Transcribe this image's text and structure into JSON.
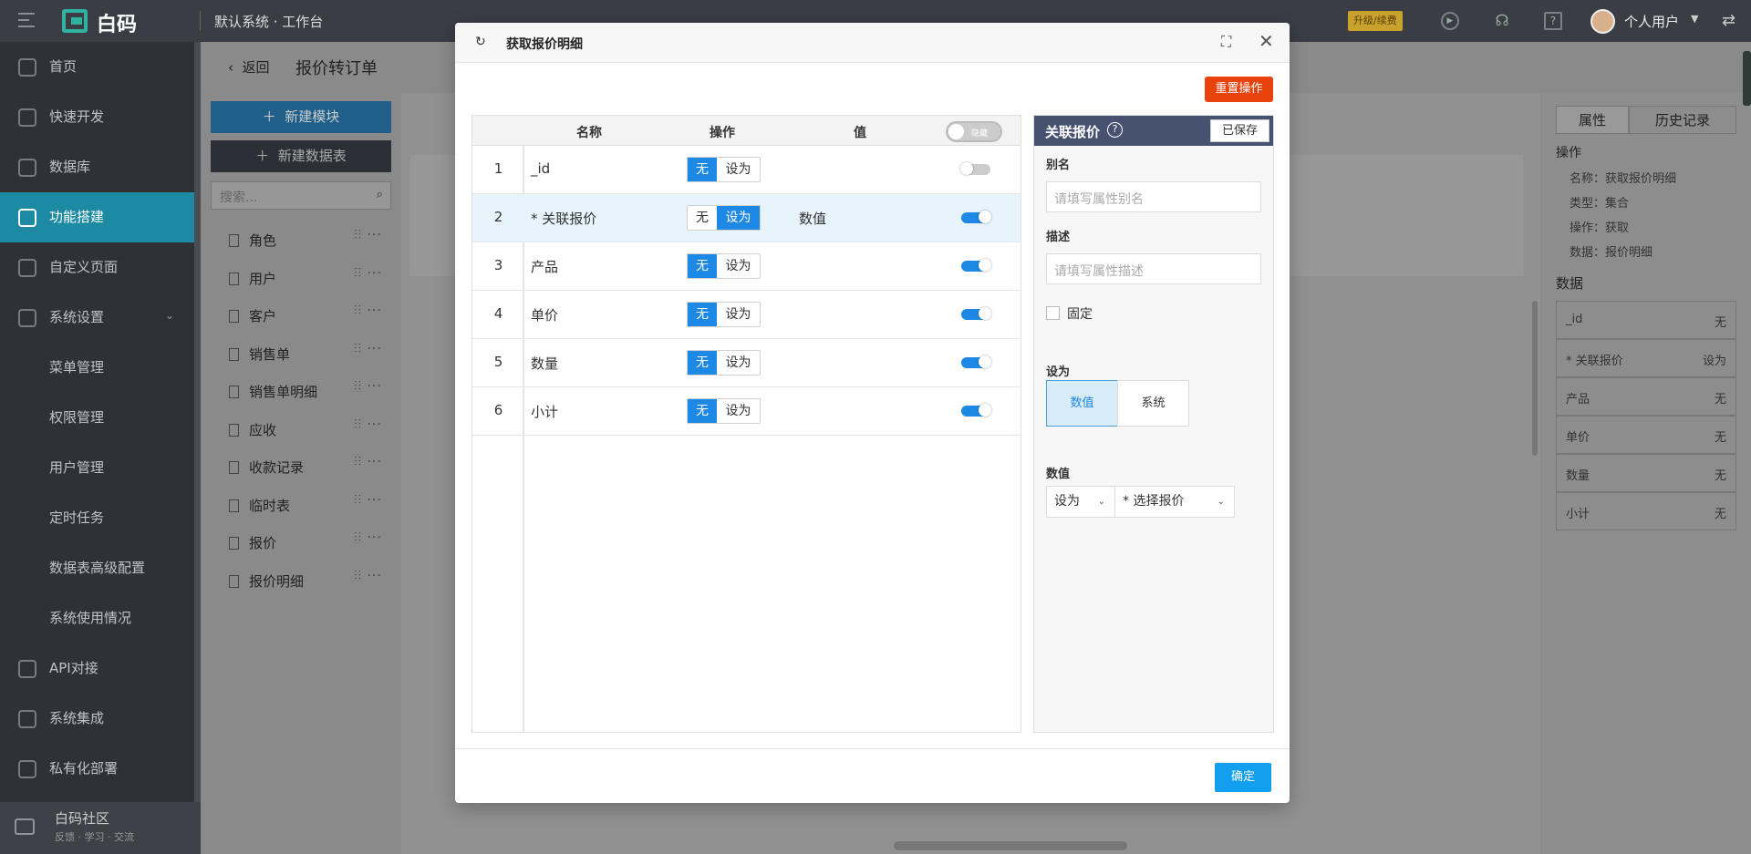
{
  "topbar": {
    "brand": "白码",
    "workspace": "默认系统 · 工作台",
    "upgrade": "升级/续费",
    "username": "个人用户"
  },
  "sidebar": {
    "items": [
      {
        "label": "首页",
        "icon": "home-icon"
      },
      {
        "label": "快速开发",
        "icon": "cube-icon"
      },
      {
        "label": "数据库",
        "icon": "database-icon"
      },
      {
        "label": "功能搭建",
        "icon": "build-icon",
        "active": true
      },
      {
        "label": "自定义页面",
        "icon": "page-icon"
      },
      {
        "label": "系统设置",
        "icon": "settings-icon",
        "expanded": true
      },
      {
        "label": "菜单管理"
      },
      {
        "label": "权限管理"
      },
      {
        "label": "用户管理"
      },
      {
        "label": "定时任务"
      },
      {
        "label": "数据表高级配置"
      },
      {
        "label": "系统使用情况"
      },
      {
        "label": "API对接",
        "icon": "api-icon"
      },
      {
        "label": "系统集成",
        "icon": "layers-icon"
      },
      {
        "label": "私有化部署",
        "icon": "lock-icon"
      }
    ],
    "community_title": "白码社区",
    "community_sub": "反馈 · 学习 · 交流"
  },
  "main": {
    "back_label": "返回",
    "page_title": "报价转订单",
    "new_module": "新建模块",
    "new_table": "新建数据表",
    "search_placeholder": "搜索...",
    "tables": [
      "角色",
      "用户",
      "客户",
      "销售单",
      "销售单明细",
      "应收",
      "收款记录",
      "临时表",
      "报价",
      "报价明细"
    ]
  },
  "right_panel": {
    "tab_props": "属性",
    "tab_history": "历史记录",
    "section_op": "操作",
    "op_name": "名称：获取报价明细",
    "op_type": "类型：集合",
    "op_action": "操作：获取",
    "op_data": "数据：报价明细",
    "section_data": "数据",
    "data_rows": [
      {
        "name": "_id",
        "value": "无"
      },
      {
        "name": "* 关联报价",
        "value": "设为"
      },
      {
        "name": "产品",
        "value": "无"
      },
      {
        "name": "单价",
        "value": "无"
      },
      {
        "name": "数量",
        "value": "无"
      },
      {
        "name": "小计",
        "value": "无"
      }
    ]
  },
  "modal": {
    "title": "获取报价明细",
    "reset": "重置操作",
    "columns": {
      "name": "名称",
      "op": "操作",
      "value": "值"
    },
    "header_toggle_label": "隐藏",
    "seg_none": "无",
    "seg_set": "设为",
    "rows": [
      {
        "idx": "1",
        "name": "_id",
        "op": "none",
        "value": "",
        "on": false
      },
      {
        "idx": "2",
        "name": "* 关联报价",
        "op": "set",
        "value": "数值",
        "on": true,
        "selected": true
      },
      {
        "idx": "3",
        "name": "产品",
        "op": "none",
        "value": "",
        "on": true
      },
      {
        "idx": "4",
        "name": "单价",
        "op": "none",
        "value": "",
        "on": true
      },
      {
        "idx": "5",
        "name": "数量",
        "op": "none",
        "value": "",
        "on": true
      },
      {
        "idx": "6",
        "name": "小计",
        "op": "none",
        "value": "",
        "on": true
      }
    ],
    "prop": {
      "title": "关联报价",
      "saved": "已保存",
      "alias_label": "别名",
      "alias_placeholder": "请填写属性别名",
      "desc_label": "描述",
      "desc_placeholder": "请填写属性描述",
      "fixed_label": "固定",
      "setas_label": "设为",
      "opt_value": "数值",
      "opt_system": "系统",
      "value_label": "数值",
      "sel_setas": "设为",
      "sel_quote": "* 选择报价"
    },
    "ok": "确定"
  }
}
